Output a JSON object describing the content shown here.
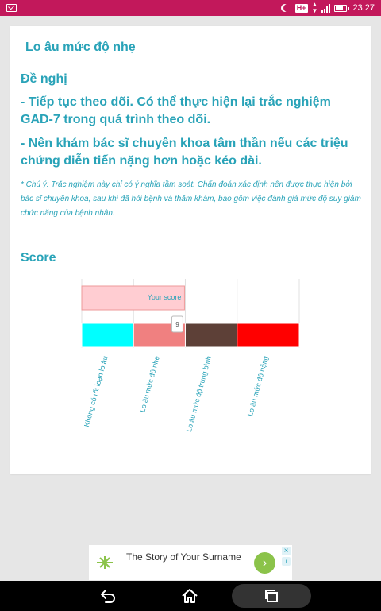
{
  "status_bar": {
    "time": "23:27",
    "network_badge": "H+",
    "icons": [
      "mail-icon",
      "moon-icon",
      "data-arrows-icon",
      "signal-icon",
      "battery-icon"
    ]
  },
  "result": {
    "title": "Lo âu mức độ nhẹ",
    "recommendation_heading": "Đề nghị",
    "recommendations": [
      "- Tiếp tục theo dõi. Có thể thực hiện lại trắc nghiệm GAD-7 trong quá trình theo dõi.",
      "- Nên khám bác sĩ chuyên khoa tâm thần nếu các triệu chứng diễn tiến nặng hơn hoặc kéo dài."
    ],
    "note": "* Chú ý: Trắc nghiệm này chỉ có ý nghĩa tầm soát. Chẩn đoán xác định nên được thực hiện bởi bác sĩ chuyên khoa, sau khi đã hỏi bệnh và thăm khám, bao gồm việc đánh giá mức độ suy giảm chức năng của bệnh nhân."
  },
  "score_section": {
    "heading": "Score"
  },
  "chart_data": {
    "type": "bar",
    "orientation": "horizontal-stacked",
    "categories": [
      "Không có rối loạn lo âu",
      "Lo âu mức độ nhẹ",
      "Lo âu mức độ trung bình",
      "Lo âu mức độ nặng"
    ],
    "segments": [
      {
        "category": "Không có rối loạn lo âu",
        "start": 0,
        "end": 5,
        "color": "#00ffff"
      },
      {
        "category": "Lo âu mức độ nhẹ",
        "start": 5,
        "end": 10,
        "color": "#f08080"
      },
      {
        "category": "Lo âu mức độ trung bình",
        "start": 10,
        "end": 15,
        "color": "#5d4037"
      },
      {
        "category": "Lo âu mức độ nặng",
        "start": 15,
        "end": 21,
        "color": "#ff0000"
      }
    ],
    "your_score": {
      "label": "Your score",
      "value": 9,
      "color": "#ffcdd2"
    },
    "xlim": [
      0,
      21
    ],
    "grid": true
  },
  "ad": {
    "text": "The Story of Your Surname",
    "arrow_icon": "chevron-right-icon",
    "close_icon": "close-icon",
    "info_icon": "ad-info-icon"
  },
  "nav_bar": {
    "icons": [
      "back-icon",
      "home-icon",
      "recent-apps-icon"
    ]
  }
}
